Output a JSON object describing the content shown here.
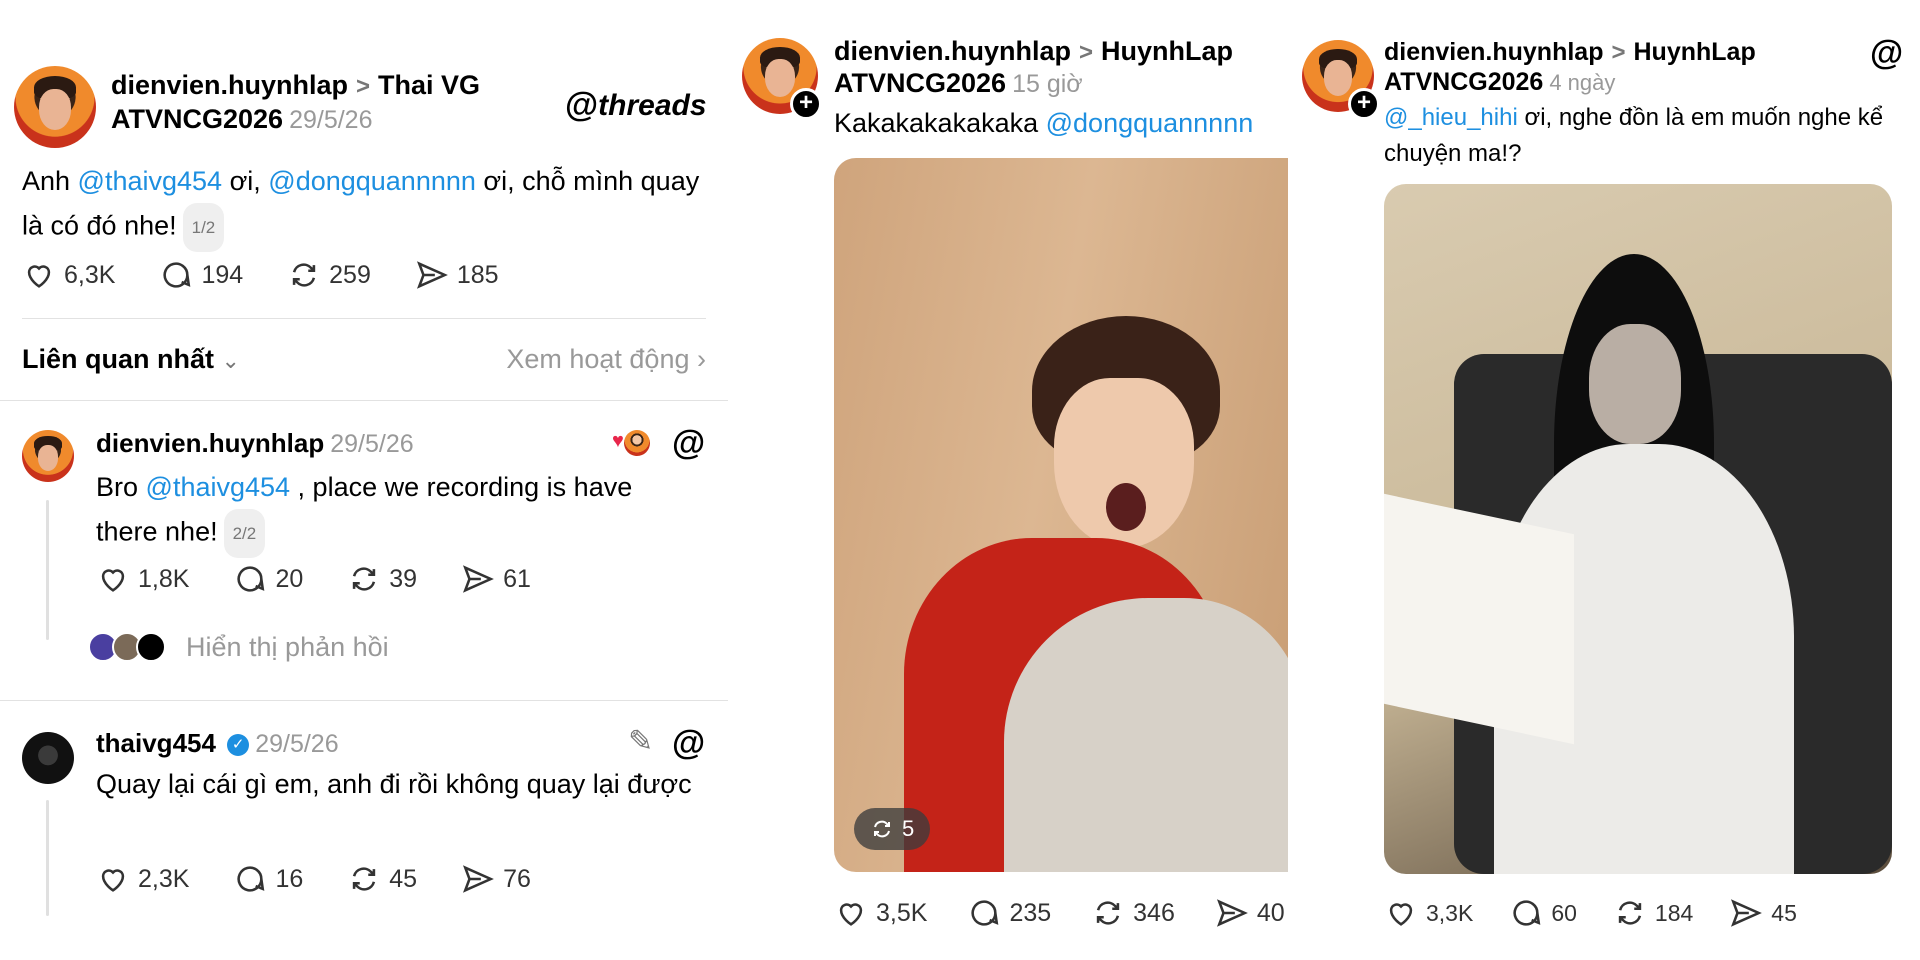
{
  "panel1": {
    "post": {
      "username": "dienvien.huynhlap",
      "chevron": ">",
      "tag_line1": "Thai VG",
      "tag_line2": "ATVNCG2026",
      "date": "29/5/26",
      "brand": "threads",
      "text_prefix": "Anh ",
      "mention1": "@thaivg454",
      "text_mid1": " ơi, ",
      "mention2": "@dongquannnnn",
      "text_mid2": " ơi, chỗ mình quay là có đó nhe!",
      "pager": "1/2",
      "likes": "6,3K",
      "comments": "194",
      "reposts": "259",
      "shares": "185"
    },
    "sort": {
      "label": "Liên quan nhất",
      "activity": "Xem hoạt động"
    },
    "reply1": {
      "username": "dienvien.huynhlap",
      "date": "29/5/26",
      "text_prefix": "Bro ",
      "mention": "@thaivg454",
      "text_rest": " , place we recording is have there nhe!",
      "pager": "2/2",
      "likes": "1,8K",
      "comments": "20",
      "reposts": "39",
      "shares": "61",
      "show_replies": "Hiển thị phản hồi"
    },
    "reply2": {
      "username": "thaivg454",
      "date": "29/5/26",
      "text": "Quay lại cái gì em, anh đi rồi không quay lại được",
      "likes": "2,3K",
      "comments": "16",
      "reposts": "45",
      "shares": "76"
    }
  },
  "panel2": {
    "username": "dienvien.huynhlap",
    "chevron": ">",
    "tag_line1": "HuynhLap",
    "tag_line2": "ATVNCG2026",
    "date": "15 giờ",
    "text": "Kakakakakakaka ",
    "mention": "@dongquannnnn",
    "repost_count": "5",
    "likes": "3,5K",
    "comments": "235",
    "reposts": "346",
    "shares": "40"
  },
  "panel3": {
    "username": "dienvien.huynhlap",
    "chevron": ">",
    "tag_line1": "HuynhLap",
    "tag_line2": "ATVNCG2026",
    "date": "4 ngày",
    "mention": "@_hieu_hihi",
    "text": "  ơi, nghe đồn là em muốn nghe kể chuyện ma!?",
    "likes": "3,3K",
    "comments": "60",
    "reposts": "184",
    "shares": "45"
  },
  "colors": {
    "mention": "#1d8fe0",
    "verified": "#1d8fe0",
    "heart": "#e8264b"
  }
}
